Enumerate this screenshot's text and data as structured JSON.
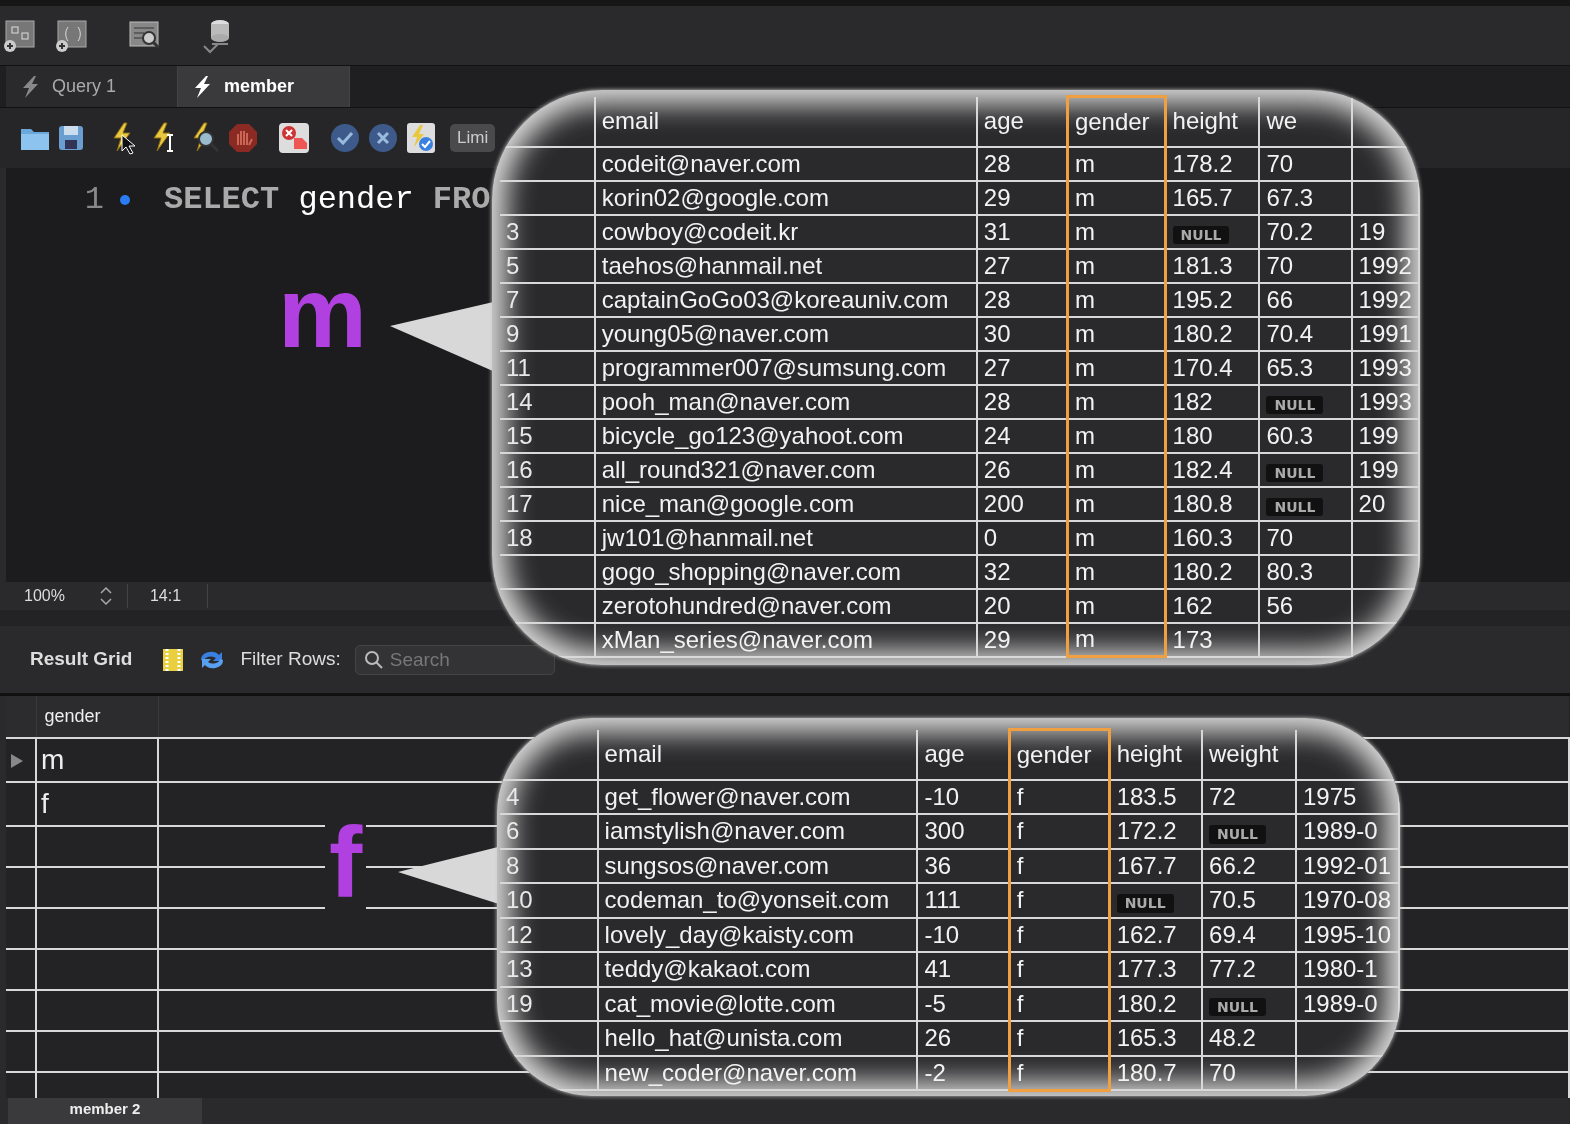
{
  "tabs": [
    {
      "label": "Query 1",
      "selected": false
    },
    {
      "label": "member",
      "selected": true
    }
  ],
  "editor_toolbar": {
    "limit_button": "Limi"
  },
  "editor": {
    "lines": [
      {
        "number": "1",
        "tokens": [
          {
            "text": "SELECT",
            "kind": "keyword"
          },
          {
            "text": "gender",
            "kind": "identifier"
          },
          {
            "text": "FRO",
            "kind": "keyword"
          }
        ]
      }
    ]
  },
  "status_bar": {
    "zoom": "100%",
    "position": "14:1"
  },
  "result_toolbar": {
    "title": "Result Grid",
    "filter_label": "Filter Rows:",
    "search": {
      "placeholder": "Search"
    }
  },
  "result_grid": {
    "columns": [
      "gender"
    ],
    "rows": [
      {
        "cells": [
          "m"
        ],
        "selected": true
      },
      {
        "cells": [
          "f"
        ],
        "selected": false
      }
    ]
  },
  "bubbles": [
    {
      "letter": "m",
      "columns": [
        {
          "label": "email",
          "highlighted": false
        },
        {
          "label": "age",
          "highlighted": false
        },
        {
          "label": "gender",
          "highlighted": true
        },
        {
          "label": "height",
          "highlighted": false
        },
        {
          "label": "we",
          "highlighted": false
        }
      ],
      "rows": [
        {
          "cells": [
            {
              "text": "codeit@naver.com",
              "kind": "value"
            },
            {
              "text": "28",
              "kind": "value"
            },
            {
              "text": "m",
              "kind": "value"
            },
            {
              "text": "178.2",
              "kind": "value"
            },
            {
              "text": "70",
              "kind": "value"
            }
          ]
        },
        {
          "cells": [
            {
              "text": "korin02@google.com",
              "kind": "value"
            },
            {
              "text": "29",
              "kind": "value"
            },
            {
              "text": "m",
              "kind": "value"
            },
            {
              "text": "165.7",
              "kind": "value"
            },
            {
              "text": "67.3",
              "kind": "value"
            }
          ]
        },
        {
          "id": "3",
          "cells": [
            {
              "text": "cowboy@codeit.kr",
              "kind": "value"
            },
            {
              "text": "31",
              "kind": "value"
            },
            {
              "text": "m",
              "kind": "value"
            },
            {
              "text": "NULL",
              "kind": "null"
            },
            {
              "text": "70.2",
              "kind": "value"
            },
            {
              "text": "19",
              "kind": "value"
            }
          ]
        },
        {
          "id": "5",
          "cells": [
            {
              "text": "taehos@hanmail.net",
              "kind": "value"
            },
            {
              "text": "27",
              "kind": "value"
            },
            {
              "text": "m",
              "kind": "value"
            },
            {
              "text": "181.3",
              "kind": "value"
            },
            {
              "text": "70",
              "kind": "value"
            },
            {
              "text": "1992",
              "kind": "value"
            }
          ]
        },
        {
          "id": "7",
          "cells": [
            {
              "text": "captainGoGo03@koreauniv.com",
              "kind": "value"
            },
            {
              "text": "28",
              "kind": "value"
            },
            {
              "text": "m",
              "kind": "value"
            },
            {
              "text": "195.2",
              "kind": "value"
            },
            {
              "text": "66",
              "kind": "value"
            },
            {
              "text": "1992",
              "kind": "value"
            }
          ]
        },
        {
          "id": "9",
          "cells": [
            {
              "text": "young05@naver.com",
              "kind": "value"
            },
            {
              "text": "30",
              "kind": "value"
            },
            {
              "text": "m",
              "kind": "value"
            },
            {
              "text": "180.2",
              "kind": "value"
            },
            {
              "text": "70.4",
              "kind": "value"
            },
            {
              "text": "1991",
              "kind": "value"
            }
          ]
        },
        {
          "id": "11",
          "cells": [
            {
              "text": "programmer007@sumsung.com",
              "kind": "value"
            },
            {
              "text": "27",
              "kind": "value"
            },
            {
              "text": "m",
              "kind": "value"
            },
            {
              "text": "170.4",
              "kind": "value"
            },
            {
              "text": "65.3",
              "kind": "value"
            },
            {
              "text": "1993",
              "kind": "value"
            }
          ]
        },
        {
          "id": "14",
          "cells": [
            {
              "text": "pooh_man@naver.com",
              "kind": "value"
            },
            {
              "text": "28",
              "kind": "value"
            },
            {
              "text": "m",
              "kind": "value"
            },
            {
              "text": "182",
              "kind": "value"
            },
            {
              "text": "NULL",
              "kind": "null"
            },
            {
              "text": "1993",
              "kind": "value"
            }
          ]
        },
        {
          "id": "15",
          "cells": [
            {
              "text": "bicycle_go123@yahoot.com",
              "kind": "value"
            },
            {
              "text": "24",
              "kind": "value"
            },
            {
              "text": "m",
              "kind": "value"
            },
            {
              "text": "180",
              "kind": "value"
            },
            {
              "text": "60.3",
              "kind": "value"
            },
            {
              "text": "199",
              "kind": "value"
            }
          ]
        },
        {
          "id": "16",
          "cells": [
            {
              "text": "all_round321@naver.com",
              "kind": "value"
            },
            {
              "text": "26",
              "kind": "value"
            },
            {
              "text": "m",
              "kind": "value"
            },
            {
              "text": "182.4",
              "kind": "value"
            },
            {
              "text": "NULL",
              "kind": "null"
            },
            {
              "text": "199",
              "kind": "value"
            }
          ]
        },
        {
          "id": "17",
          "cells": [
            {
              "text": "nice_man@google.com",
              "kind": "value"
            },
            {
              "text": "200",
              "kind": "value"
            },
            {
              "text": "m",
              "kind": "value"
            },
            {
              "text": "180.8",
              "kind": "value"
            },
            {
              "text": "NULL",
              "kind": "null"
            },
            {
              "text": "20",
              "kind": "value"
            }
          ]
        },
        {
          "id": "18",
          "cells": [
            {
              "text": "jw101@hanmail.net",
              "kind": "value"
            },
            {
              "text": "0",
              "kind": "value"
            },
            {
              "text": "m",
              "kind": "value"
            },
            {
              "text": "160.3",
              "kind": "value"
            },
            {
              "text": "70",
              "kind": "value"
            }
          ]
        },
        {
          "cells": [
            {
              "text": "gogo_shopping@naver.com",
              "kind": "value"
            },
            {
              "text": "32",
              "kind": "value"
            },
            {
              "text": "m",
              "kind": "value"
            },
            {
              "text": "180.2",
              "kind": "value"
            },
            {
              "text": "80.3",
              "kind": "value"
            }
          ]
        },
        {
          "cells": [
            {
              "text": "zerotohundred@naver.com",
              "kind": "value"
            },
            {
              "text": "20",
              "kind": "value"
            },
            {
              "text": "m",
              "kind": "value"
            },
            {
              "text": "162",
              "kind": "value"
            },
            {
              "text": "56",
              "kind": "value"
            }
          ]
        },
        {
          "cells": [
            {
              "text": "xMan_series@naver.com",
              "kind": "value"
            },
            {
              "text": "29",
              "kind": "value"
            },
            {
              "text": "m",
              "kind": "value"
            },
            {
              "text": "173",
              "kind": "value"
            }
          ]
        }
      ]
    },
    {
      "letter": "f",
      "columns": [
        {
          "label": "email",
          "highlighted": false
        },
        {
          "label": "age",
          "highlighted": false
        },
        {
          "label": "gender",
          "highlighted": true
        },
        {
          "label": "height",
          "highlighted": false
        },
        {
          "label": "weight",
          "highlighted": false
        }
      ],
      "rows": [
        {
          "id": "4",
          "cells": [
            {
              "text": "get_flower@naver.com",
              "kind": "value"
            },
            {
              "text": "-10",
              "kind": "value"
            },
            {
              "text": "f",
              "kind": "value"
            },
            {
              "text": "183.5",
              "kind": "value"
            },
            {
              "text": "72",
              "kind": "value"
            },
            {
              "text": "1975",
              "kind": "value"
            }
          ]
        },
        {
          "id": "6",
          "cells": [
            {
              "text": "iamstylish@naver.com",
              "kind": "value"
            },
            {
              "text": "300",
              "kind": "value"
            },
            {
              "text": "f",
              "kind": "value"
            },
            {
              "text": "172.2",
              "kind": "value"
            },
            {
              "text": "NULL",
              "kind": "null"
            },
            {
              "text": "1989-0",
              "kind": "value"
            }
          ]
        },
        {
          "id": "8",
          "cells": [
            {
              "text": "sungsos@naver.com",
              "kind": "value"
            },
            {
              "text": "36",
              "kind": "value"
            },
            {
              "text": "f",
              "kind": "value"
            },
            {
              "text": "167.7",
              "kind": "value"
            },
            {
              "text": "66.2",
              "kind": "value"
            },
            {
              "text": "1992-01",
              "kind": "value"
            }
          ]
        },
        {
          "id": "10",
          "cells": [
            {
              "text": "codeman_to@yonseit.com",
              "kind": "value"
            },
            {
              "text": "111",
              "kind": "value"
            },
            {
              "text": "f",
              "kind": "value"
            },
            {
              "text": "NULL",
              "kind": "null"
            },
            {
              "text": "70.5",
              "kind": "value"
            },
            {
              "text": "1970-08",
              "kind": "value"
            }
          ]
        },
        {
          "id": "12",
          "cells": [
            {
              "text": "lovely_day@kaisty.com",
              "kind": "value"
            },
            {
              "text": "-10",
              "kind": "value"
            },
            {
              "text": "f",
              "kind": "value"
            },
            {
              "text": "162.7",
              "kind": "value"
            },
            {
              "text": "69.4",
              "kind": "value"
            },
            {
              "text": "1995-10",
              "kind": "value"
            }
          ]
        },
        {
          "id": "13",
          "cells": [
            {
              "text": "teddy@kakaot.com",
              "kind": "value"
            },
            {
              "text": "41",
              "kind": "value"
            },
            {
              "text": "f",
              "kind": "value"
            },
            {
              "text": "177.3",
              "kind": "value"
            },
            {
              "text": "77.2",
              "kind": "value"
            },
            {
              "text": "1980-1",
              "kind": "value"
            }
          ]
        },
        {
          "id": "19",
          "cells": [
            {
              "text": "cat_movie@lotte.com",
              "kind": "value"
            },
            {
              "text": "-5",
              "kind": "value"
            },
            {
              "text": "f",
              "kind": "value"
            },
            {
              "text": "180.2",
              "kind": "value"
            },
            {
              "text": "NULL",
              "kind": "null"
            },
            {
              "text": "1989-0",
              "kind": "value"
            }
          ]
        },
        {
          "cells": [
            {
              "text": "hello_hat@unista.com",
              "kind": "value"
            },
            {
              "text": "26",
              "kind": "value"
            },
            {
              "text": "f",
              "kind": "value"
            },
            {
              "text": "165.3",
              "kind": "value"
            },
            {
              "text": "48.2",
              "kind": "value"
            }
          ]
        },
        {
          "cells": [
            {
              "text": "new_coder@naver.com",
              "kind": "value"
            },
            {
              "text": "-2",
              "kind": "value"
            },
            {
              "text": "f",
              "kind": "value"
            },
            {
              "text": "180.7",
              "kind": "value"
            },
            {
              "text": "70",
              "kind": "value"
            }
          ]
        }
      ]
    }
  ],
  "bottom_tabs": [
    {
      "label": "member 2",
      "selected": true
    }
  ]
}
